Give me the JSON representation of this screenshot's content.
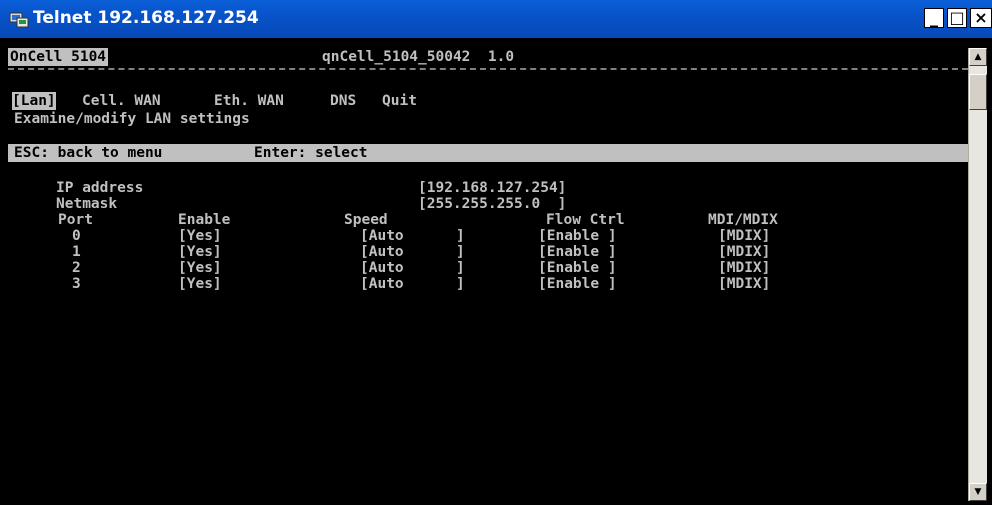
{
  "window": {
    "title": "Telnet 192.168.127.254",
    "minimize_symbol": "_",
    "maximize_symbol": "□",
    "close_symbol": "×",
    "icon": "telnet-app-icon"
  },
  "console": {
    "header": {
      "device_name": "OnCell 5104",
      "model_version": "qnCell_5104_50042  1.0"
    },
    "menu": [
      {
        "label": "[Lan]",
        "selected": true
      },
      {
        "label": "Cell. WAN",
        "selected": false
      },
      {
        "label": "Eth. WAN",
        "selected": false
      },
      {
        "label": "DNS",
        "selected": false
      },
      {
        "label": "Quit",
        "selected": false
      }
    ],
    "description": "Examine/modify LAN settings",
    "statusbar": {
      "esc_hint": "ESC: back to menu",
      "enter_hint": "Enter: select"
    },
    "fields": {
      "ip_label": "IP address",
      "ip_value": "[192.168.127.254]",
      "netmask_label": "Netmask",
      "netmask_value": "[255.255.255.0  ]"
    },
    "port_table": {
      "headers": [
        "Port",
        "Enable",
        "Speed",
        "Flow Ctrl",
        "MDI/MDIX"
      ],
      "rows": [
        [
          "0",
          "[Yes]",
          "[Auto      ]",
          "[Enable ]",
          "[MDIX]"
        ],
        [
          "1",
          "[Yes]",
          "[Auto      ]",
          "[Enable ]",
          "[MDIX]"
        ],
        [
          "2",
          "[Yes]",
          "[Auto      ]",
          "[Enable ]",
          "[MDIX]"
        ],
        [
          "3",
          "[Yes]",
          "[Auto      ]",
          "[Enable ]",
          "[MDIX]"
        ]
      ]
    }
  },
  "scrollbar": {
    "up_arrow": "▲",
    "down_arrow": "▼"
  },
  "colors": {
    "titlebar": "#0853c9",
    "console_bg": "#000000",
    "console_fg": "#c0c0c0",
    "highlight_bg": "#c0c0c0"
  }
}
